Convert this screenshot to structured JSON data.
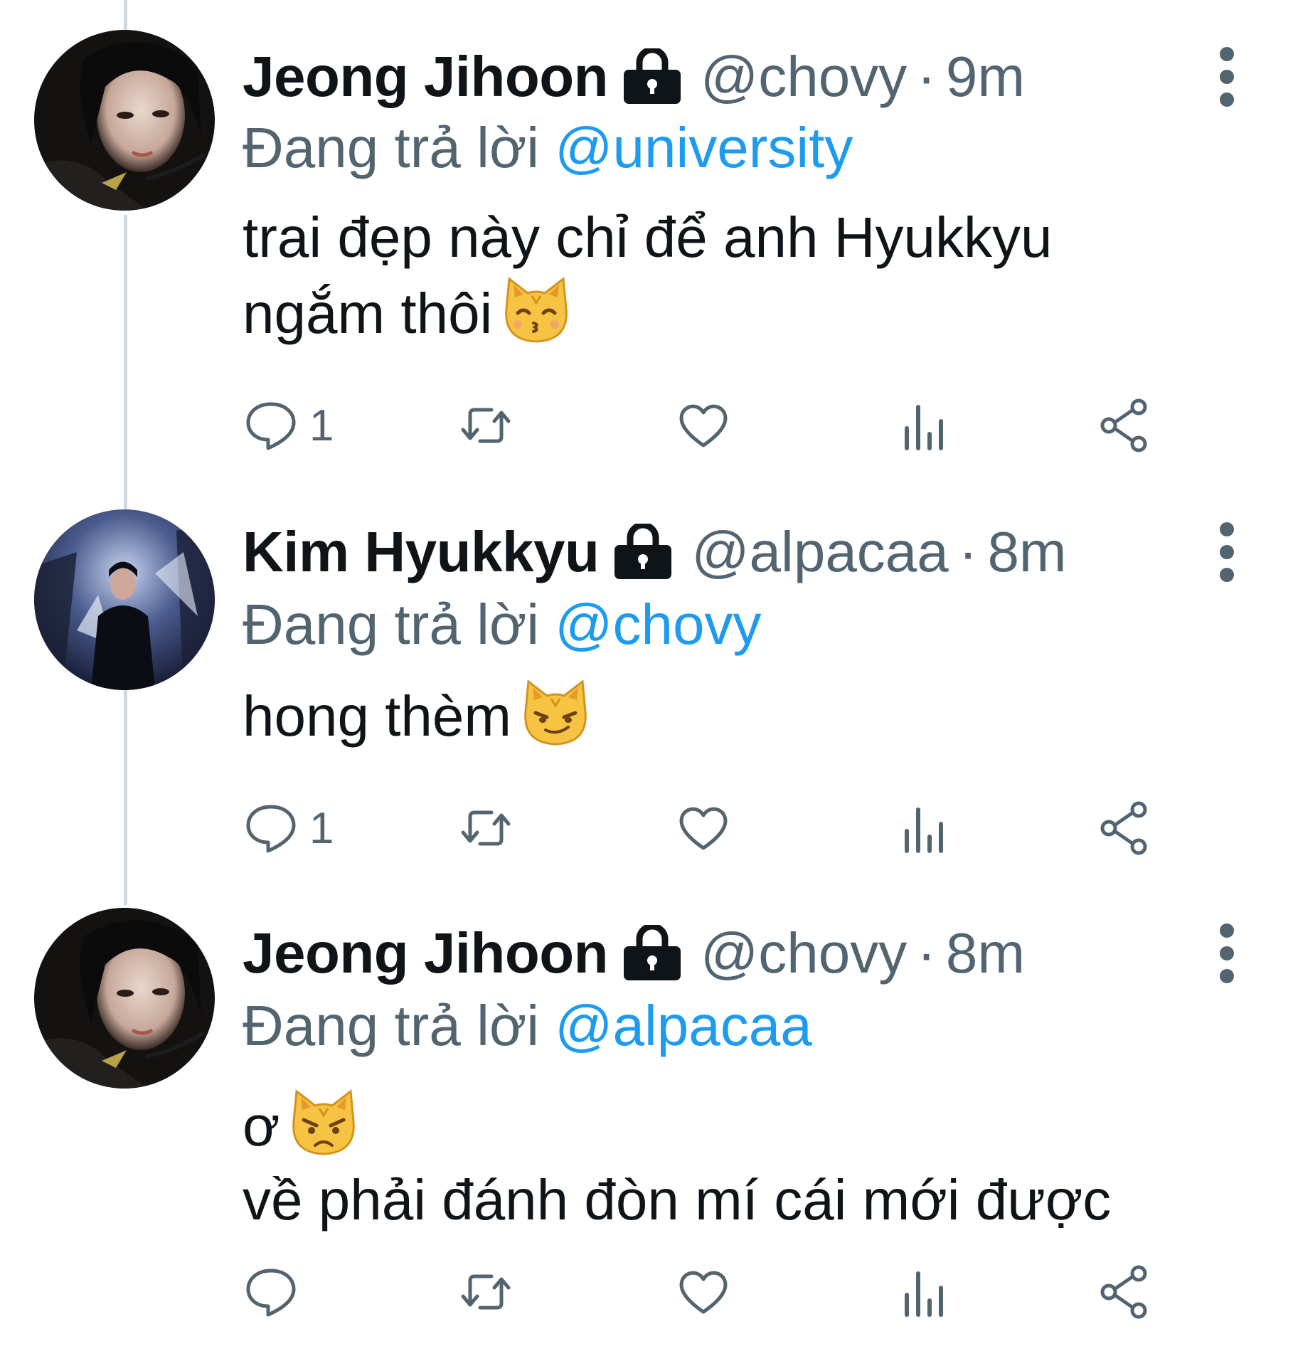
{
  "colors": {
    "text": "#0f1419",
    "secondary": "#536471",
    "accent": "#1d9bf0",
    "thread_line": "#cfd9de"
  },
  "tweets": [
    {
      "name": "Jeong Jihoon",
      "handle": "@chovy",
      "separator": "·",
      "time": "9m",
      "reply_prefix": "Đang trả lời ",
      "reply_to": "@university",
      "lines": [
        "trai đẹp này chỉ để anh Hyukkyu",
        "ngắm thôi"
      ],
      "emoji": "kissing-cat-emoji",
      "reply_count": "1",
      "icons": [
        "lock-icon",
        "more-icon",
        "reply-icon",
        "retweet-icon",
        "like-icon",
        "analytics-icon",
        "share-icon"
      ]
    },
    {
      "name": "Kim Hyukkyu",
      "handle": "@alpacaa",
      "separator": "·",
      "time": "8m",
      "reply_prefix": "Đang trả lời ",
      "reply_to": "@chovy",
      "lines": [
        "hong thèm"
      ],
      "emoji": "smirking-cat-emoji",
      "reply_count": "1",
      "icons": [
        "lock-icon",
        "more-icon",
        "reply-icon",
        "retweet-icon",
        "like-icon",
        "analytics-icon",
        "share-icon"
      ]
    },
    {
      "name": "Jeong Jihoon",
      "handle": "@chovy",
      "separator": "·",
      "time": "8m",
      "reply_prefix": "Đang trả lời ",
      "reply_to": "@alpacaa",
      "lines": [
        "ơ",
        "về phải đánh đòn mí cái mới được"
      ],
      "emoji": "pouting-cat-emoji",
      "reply_count": "",
      "icons": [
        "lock-icon",
        "more-icon",
        "reply-icon",
        "retweet-icon",
        "like-icon",
        "analytics-icon",
        "share-icon"
      ]
    }
  ]
}
